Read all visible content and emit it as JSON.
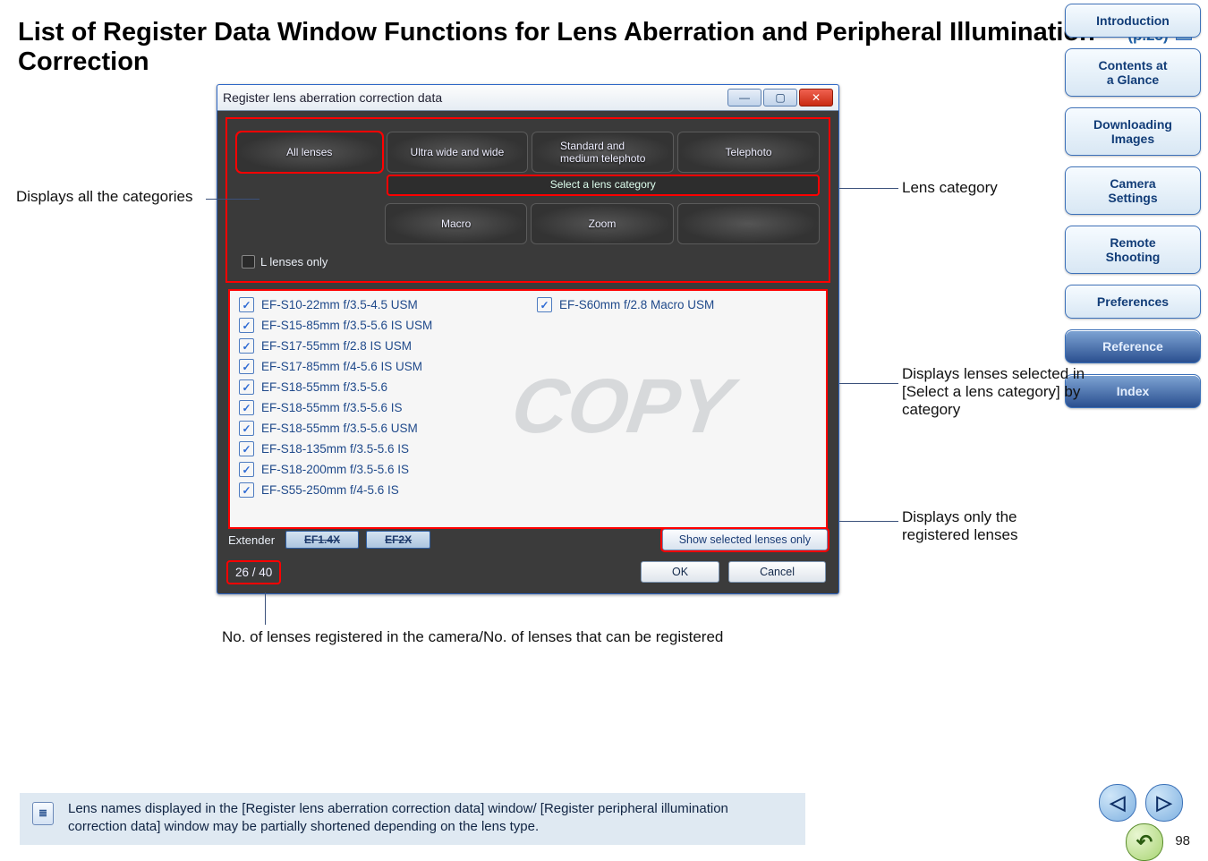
{
  "title": {
    "main": "List of Register Data Window Functions for Lens Aberration and Peripheral Illumination Correction",
    "page_ref": "(p.25)"
  },
  "sidebar": {
    "items": [
      {
        "label": "Introduction"
      },
      {
        "label": "Contents at\na Glance"
      },
      {
        "label": "Downloading\nImages"
      },
      {
        "label": "Camera\nSettings"
      },
      {
        "label": "Remote\nShooting"
      },
      {
        "label": "Preferences"
      },
      {
        "label": "Reference",
        "dark": true
      },
      {
        "label": "Index",
        "dark": true
      }
    ]
  },
  "dialog": {
    "title": "Register lens aberration correction data",
    "window_buttons": {
      "min": "—",
      "max": "▢",
      "close": "✕"
    },
    "categories": {
      "all": "All lenses",
      "ultra": "Ultra wide and wide",
      "std": "Standard and\nmedium telephoto",
      "tele": "Telephoto",
      "select": "Select a lens category",
      "macro": "Macro",
      "zoom": "Zoom",
      "l_only": "L lenses only"
    },
    "lens_list_left": [
      "EF-S10-22mm f/3.5-4.5 USM",
      "EF-S15-85mm f/3.5-5.6 IS USM",
      "EF-S17-55mm f/2.8 IS USM",
      "EF-S17-85mm f/4-5.6 IS USM",
      "EF-S18-55mm f/3.5-5.6",
      "EF-S18-55mm f/3.5-5.6 IS",
      "EF-S18-55mm f/3.5-5.6 USM",
      "EF-S18-135mm f/3.5-5.6 IS",
      "EF-S18-200mm f/3.5-5.6 IS",
      "EF-S55-250mm f/4-5.6 IS"
    ],
    "lens_list_right": [
      "EF-S60mm f/2.8 Macro USM"
    ],
    "extender_label": "Extender",
    "extender_buttons": [
      "EF1.4X",
      "EF2X"
    ],
    "show_selected": "Show selected lenses only",
    "counter": "26 / 40",
    "ok": "OK",
    "cancel": "Cancel",
    "watermark": "COPY"
  },
  "callouts": {
    "left": "Displays all the categories",
    "lens_category": "Lens category",
    "selected": "Displays lenses selected in [Select a lens category] by category",
    "show_only": "Displays only the registered lenses",
    "counter": "No. of lenses registered in the camera/No. of lenses that can be registered"
  },
  "note": "Lens names displayed in the [Register lens aberration correction data] window/ [Register peripheral illumination correction data] window may be partially shortened depending on the lens type.",
  "page_number": "98"
}
